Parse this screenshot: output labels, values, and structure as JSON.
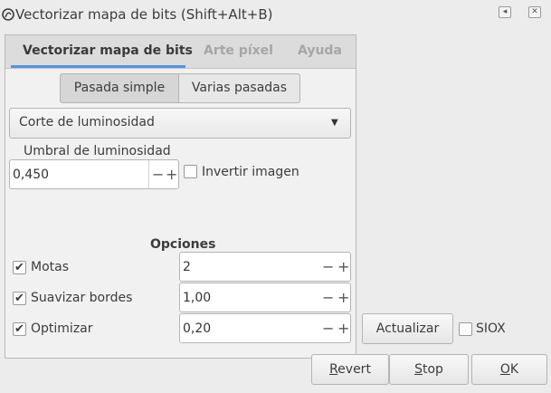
{
  "window": {
    "title": "Vectorizar mapa de bits (Shift+Alt+B)",
    "icon": "trace-bitmap-icon",
    "restore_glyph": "◂",
    "close_glyph": "✕"
  },
  "tabs": [
    {
      "label": "Vectorizar mapa de bits",
      "active": true
    },
    {
      "label": "Arte píxel",
      "active": false
    },
    {
      "label": "Ayuda",
      "active": false
    }
  ],
  "mode_buttons": [
    {
      "label": "Pasada simple",
      "selected": true
    },
    {
      "label": "Varias pasadas",
      "selected": false
    }
  ],
  "mode_select": {
    "value": "Corte de luminosidad"
  },
  "threshold": {
    "label": "Umbral de luminosidad",
    "value": "0,450"
  },
  "invert": {
    "label": "Invertir imagen",
    "checked": false
  },
  "options": {
    "title": "Opciones",
    "items": [
      {
        "label": "Motas",
        "checked": true,
        "value": "2"
      },
      {
        "label": "Suavizar bordes",
        "checked": true,
        "value": "1,00"
      },
      {
        "label": "Optimizar",
        "checked": true,
        "value": "0,20"
      }
    ]
  },
  "spin": {
    "minus": "−",
    "plus": "+"
  },
  "checkmark": "✔",
  "update_button": "Actualizar",
  "siox": {
    "label": "SIOX",
    "checked": false
  },
  "buttons": {
    "revert": {
      "mnemonic": "R",
      "rest": "evert"
    },
    "stop": {
      "mnemonic": "S",
      "rest": "top"
    },
    "ok": {
      "mnemonic": "O",
      "rest": "K"
    }
  },
  "colors": {
    "accent": "#5294e2",
    "background": "#ececec"
  }
}
